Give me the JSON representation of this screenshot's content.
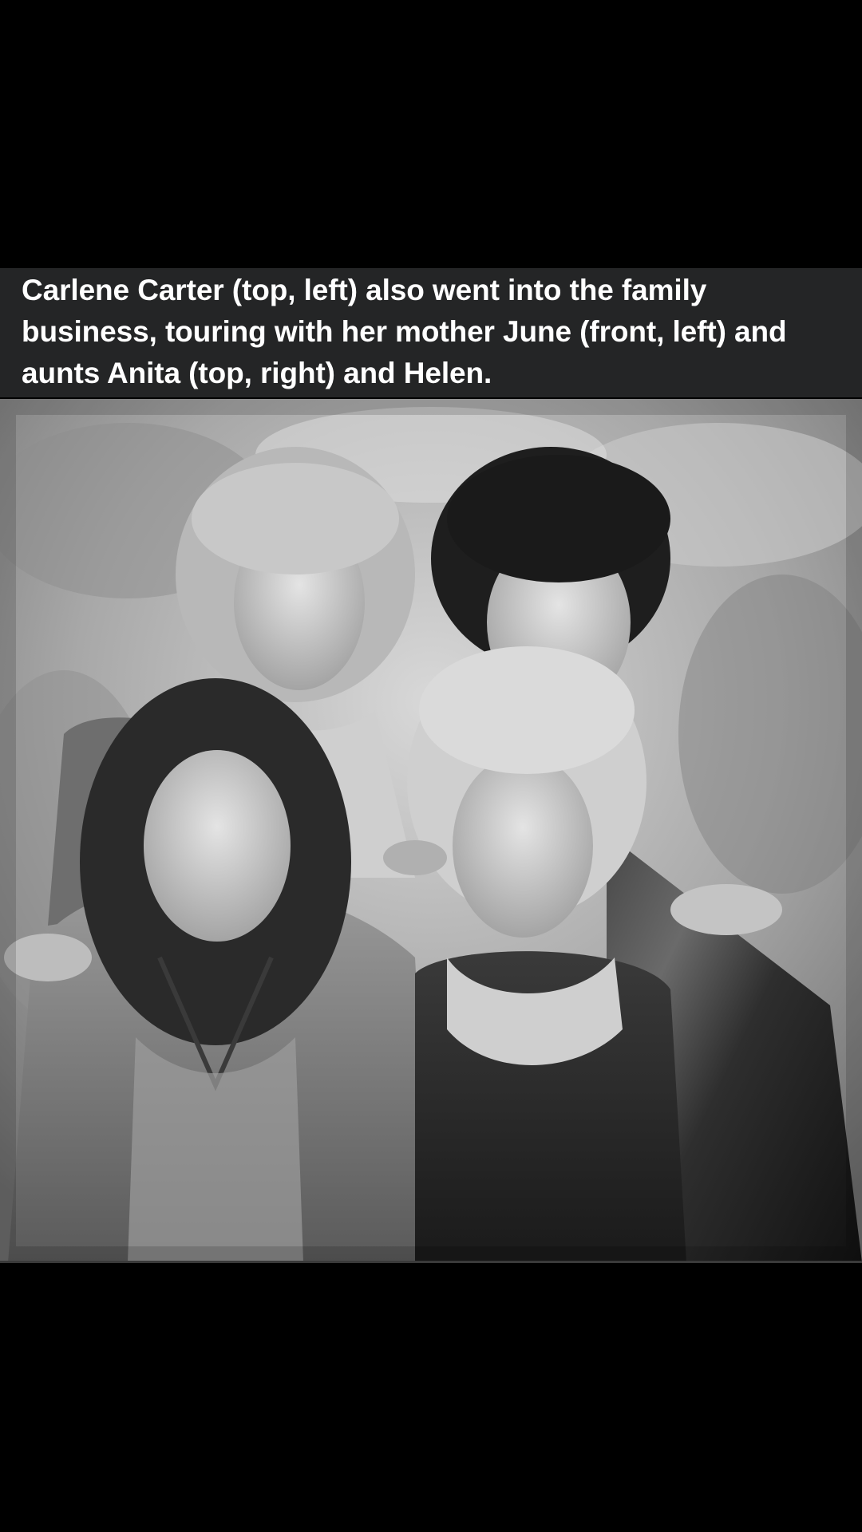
{
  "post": {
    "caption": "Carlene Carter (top, left) also went into the family business, touring with her mother June (front, left) and aunts Anita (top, right) and Helen.",
    "photo": {
      "kind": "black-and-white group portrait photograph"
    }
  },
  "colors": {
    "background": "#000000",
    "caption_bar": "#242526",
    "caption_text": "#ffffff"
  }
}
